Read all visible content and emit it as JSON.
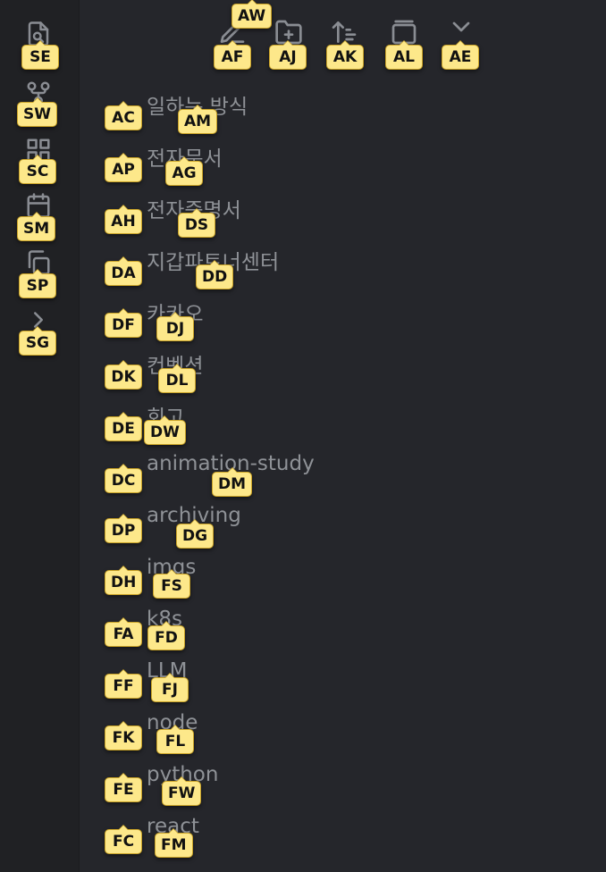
{
  "ribbon": {
    "items": [
      {
        "icon": "file-search-icon",
        "hint": "SE"
      },
      {
        "icon": "git-branch-icon",
        "hint": "SW"
      },
      {
        "icon": "layout-grid-icon",
        "hint": "SC"
      },
      {
        "icon": "calendar-icon",
        "hint": "SM"
      },
      {
        "icon": "copy-icon",
        "hint": "SP"
      },
      {
        "icon": "chevron-right-icon",
        "hint": "SG"
      }
    ]
  },
  "toolbar": {
    "hint_top": "AW",
    "buttons": [
      {
        "icon": "new-note-icon",
        "hint": "AF"
      },
      {
        "icon": "new-folder-icon",
        "hint": "AJ"
      },
      {
        "icon": "sort-icon",
        "hint": "AK"
      },
      {
        "icon": "collapse-all-icon",
        "hint": "AL"
      },
      {
        "icon": "chevron-down-icon",
        "hint": "AE"
      }
    ]
  },
  "tree": {
    "items": [
      {
        "label": "일하는 방식",
        "hint_chevron": "AC",
        "hint_label": "AM"
      },
      {
        "label": "전자문서",
        "hint_chevron": "AP",
        "hint_label": "AG"
      },
      {
        "label": "전자증명서",
        "hint_chevron": "AH",
        "hint_label": "DS"
      },
      {
        "label": "지갑파트너센터",
        "hint_chevron": "DA",
        "hint_label": "DD"
      },
      {
        "label": "카카오",
        "hint_chevron": "DF",
        "hint_label": "DJ"
      },
      {
        "label": "컨벤션",
        "hint_chevron": "DK",
        "hint_label": "DL"
      },
      {
        "label": "회고",
        "hint_chevron": "DE",
        "hint_label": "DW"
      },
      {
        "label": "animation-study",
        "hint_chevron": "DC",
        "hint_label": "DM"
      },
      {
        "label": "archiving",
        "hint_chevron": "DP",
        "hint_label": "DG"
      },
      {
        "label": "imgs",
        "hint_chevron": "DH",
        "hint_label": "FS"
      },
      {
        "label": "k8s",
        "hint_chevron": "FA",
        "hint_label": "FD"
      },
      {
        "label": "LLM",
        "hint_chevron": "FF",
        "hint_label": "FJ"
      },
      {
        "label": "node",
        "hint_chevron": "FK",
        "hint_label": "FL"
      },
      {
        "label": "python",
        "hint_chevron": "FE",
        "hint_label": "FW"
      },
      {
        "label": "react",
        "hint_chevron": "FC",
        "hint_label": "FM"
      }
    ]
  },
  "colors": {
    "background": "#25262b",
    "ribbon": "#202124",
    "hint_bg": "#fde88a",
    "text": "#8f9297"
  }
}
